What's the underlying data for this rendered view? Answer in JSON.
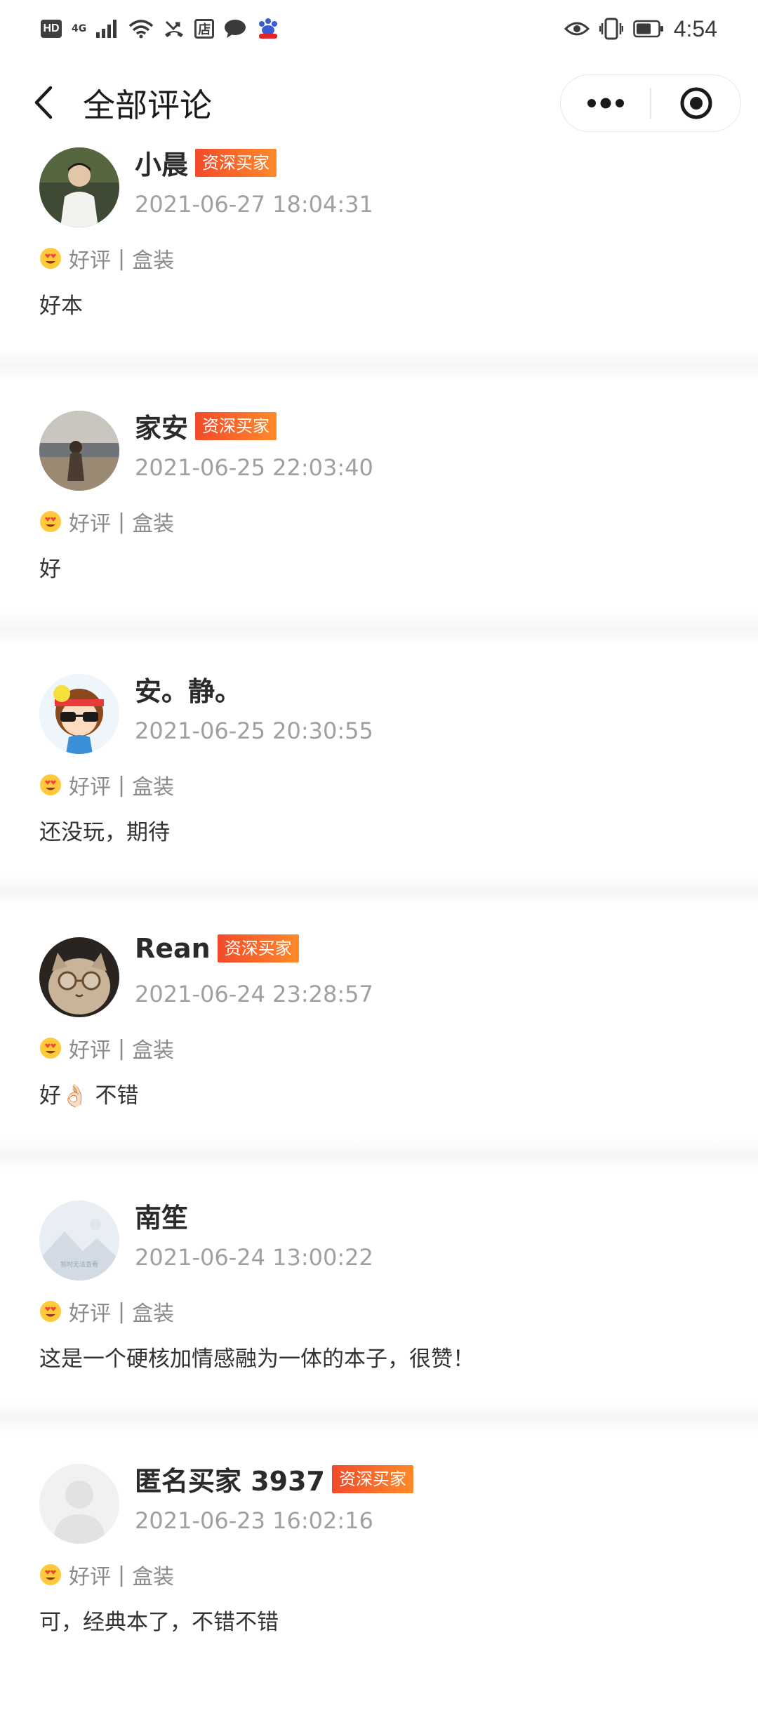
{
  "status_bar": {
    "hd": "HD",
    "network": "4G",
    "store_glyph": "店",
    "time": "4:54",
    "icons": [
      "signal-icon",
      "wifi-icon",
      "missed-call-icon",
      "store-icon",
      "message-icon",
      "baidu-icon",
      "eye-icon",
      "vibrate-icon",
      "battery-icon"
    ]
  },
  "header": {
    "title": "全部评论",
    "back_icon": "chevron-left-icon",
    "more_icon": "more-dots-icon",
    "close_icon": "target-close-icon"
  },
  "reviews": [
    {
      "name": "小晨",
      "badge": "资深买家",
      "time": "2021-06-27 18:04:31",
      "rating": "好评",
      "sep": "|",
      "variant": "盒装",
      "comment": "好本",
      "avatar": "avatar-photo-person"
    },
    {
      "name": "家安",
      "badge": "资深买家",
      "time": "2021-06-25 22:03:40",
      "rating": "好评",
      "sep": "|",
      "variant": "盒装",
      "comment": "好",
      "avatar": "avatar-photo-beach"
    },
    {
      "name": "安。静。",
      "badge": "",
      "time": "2021-06-25 20:30:55",
      "rating": "好评",
      "sep": "|",
      "variant": "盒装",
      "comment": "还没玩，期待",
      "avatar": "avatar-cartoon-girl"
    },
    {
      "name": "Rean",
      "badge": "资深买家",
      "time": "2021-06-24 23:28:57",
      "rating": "好评",
      "sep": "|",
      "variant": "盒装",
      "comment": "好👌🏻 不错",
      "avatar": "avatar-cat-glasses"
    },
    {
      "name": "南笙",
      "badge": "",
      "time": "2021-06-24 13:00:22",
      "rating": "好评",
      "sep": "|",
      "variant": "盒装",
      "comment": "这是一个硬核加情感融为一体的本子，很赞！",
      "avatar": "avatar-placeholder-landscape",
      "avatar_text": "暂时无法查看"
    },
    {
      "name": "匿名买家 3937",
      "badge": "资深买家",
      "time": "2021-06-23 16:02:16",
      "rating": "好评",
      "sep": "|",
      "variant": "盒装",
      "comment": "可，经典本了，不错不错",
      "avatar": "avatar-anonymous"
    }
  ],
  "colors": {
    "badge_start": "#f34a2a",
    "badge_end": "#ff8a2a",
    "timestamp": "#a0a0a0",
    "rating_text": "#8a8a8a"
  }
}
